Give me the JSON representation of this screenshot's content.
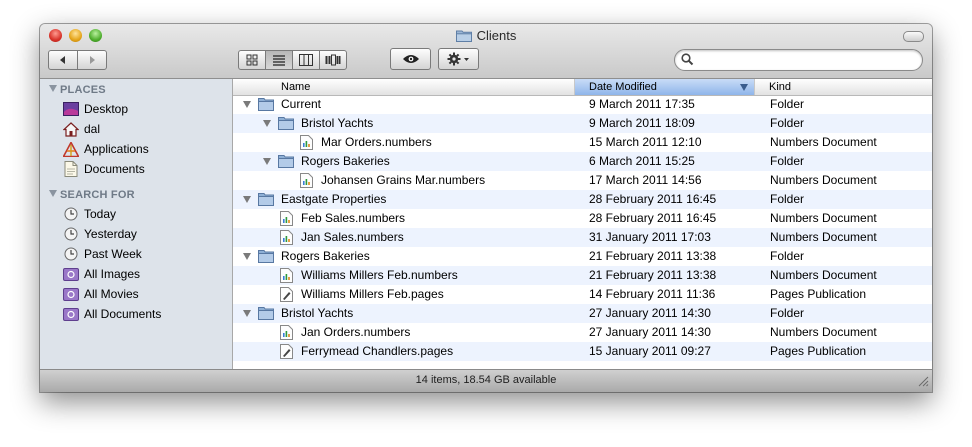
{
  "window": {
    "title": "Clients"
  },
  "sidebar": {
    "sections": [
      {
        "label": "PLACES",
        "items": [
          {
            "label": "Desktop",
            "icon": "desktop-icon"
          },
          {
            "label": "dal",
            "icon": "home-icon"
          },
          {
            "label": "Applications",
            "icon": "applications-icon"
          },
          {
            "label": "Documents",
            "icon": "documents-icon"
          }
        ]
      },
      {
        "label": "SEARCH FOR",
        "items": [
          {
            "label": "Today",
            "icon": "clock-icon"
          },
          {
            "label": "Yesterday",
            "icon": "clock-icon"
          },
          {
            "label": "Past Week",
            "icon": "clock-icon"
          },
          {
            "label": "All Images",
            "icon": "smart-folder-icon"
          },
          {
            "label": "All Movies",
            "icon": "smart-folder-icon"
          },
          {
            "label": "All Documents",
            "icon": "smart-folder-icon"
          }
        ]
      }
    ]
  },
  "columns": {
    "name": "Name",
    "date": "Date Modified",
    "kind": "Kind"
  },
  "sort": {
    "column": "Date Modified",
    "direction": "descending"
  },
  "rows": [
    {
      "name": "Current",
      "date": "9 March 2011 17:35",
      "kind": "Folder",
      "type": "folder",
      "level": 0,
      "expanded": true
    },
    {
      "name": "Bristol Yachts",
      "date": "9 March 2011 18:09",
      "kind": "Folder",
      "type": "folder",
      "level": 1,
      "expanded": true
    },
    {
      "name": "Mar Orders.numbers",
      "date": "15 March 2011 12:10",
      "kind": "Numbers Document",
      "type": "numbers",
      "level": 2
    },
    {
      "name": "Rogers Bakeries",
      "date": "6 March 2011 15:25",
      "kind": "Folder",
      "type": "folder",
      "level": 1,
      "expanded": true
    },
    {
      "name": "Johansen Grains Mar.numbers",
      "date": "17 March 2011 14:56",
      "kind": "Numbers Document",
      "type": "numbers",
      "level": 2
    },
    {
      "name": "Eastgate Properties",
      "date": "28 February 2011 16:45",
      "kind": "Folder",
      "type": "folder",
      "level": 0,
      "expanded": true
    },
    {
      "name": "Feb Sales.numbers",
      "date": "28 February 2011 16:45",
      "kind": "Numbers Document",
      "type": "numbers",
      "level": 1
    },
    {
      "name": "Jan Sales.numbers",
      "date": "31 January 2011 17:03",
      "kind": "Numbers Document",
      "type": "numbers",
      "level": 1
    },
    {
      "name": "Rogers Bakeries",
      "date": "21 February 2011 13:38",
      "kind": "Folder",
      "type": "folder",
      "level": 0,
      "expanded": true
    },
    {
      "name": "Williams Millers Feb.numbers",
      "date": "21 February 2011 13:38",
      "kind": "Numbers Document",
      "type": "numbers",
      "level": 1
    },
    {
      "name": "Williams Millers Feb.pages",
      "date": "14 February 2011 11:36",
      "kind": "Pages Publication",
      "type": "pages",
      "level": 1
    },
    {
      "name": "Bristol Yachts",
      "date": "27 January 2011 14:30",
      "kind": "Folder",
      "type": "folder",
      "level": 0,
      "expanded": true
    },
    {
      "name": "Jan Orders.numbers",
      "date": "27 January 2011 14:30",
      "kind": "Numbers Document",
      "type": "numbers",
      "level": 1
    },
    {
      "name": "Ferrymead Chandlers.pages",
      "date": "15 January 2011 09:27",
      "kind": "Pages Publication",
      "type": "pages",
      "level": 1
    }
  ],
  "status": {
    "text": "14 items, 18.54 GB available"
  }
}
